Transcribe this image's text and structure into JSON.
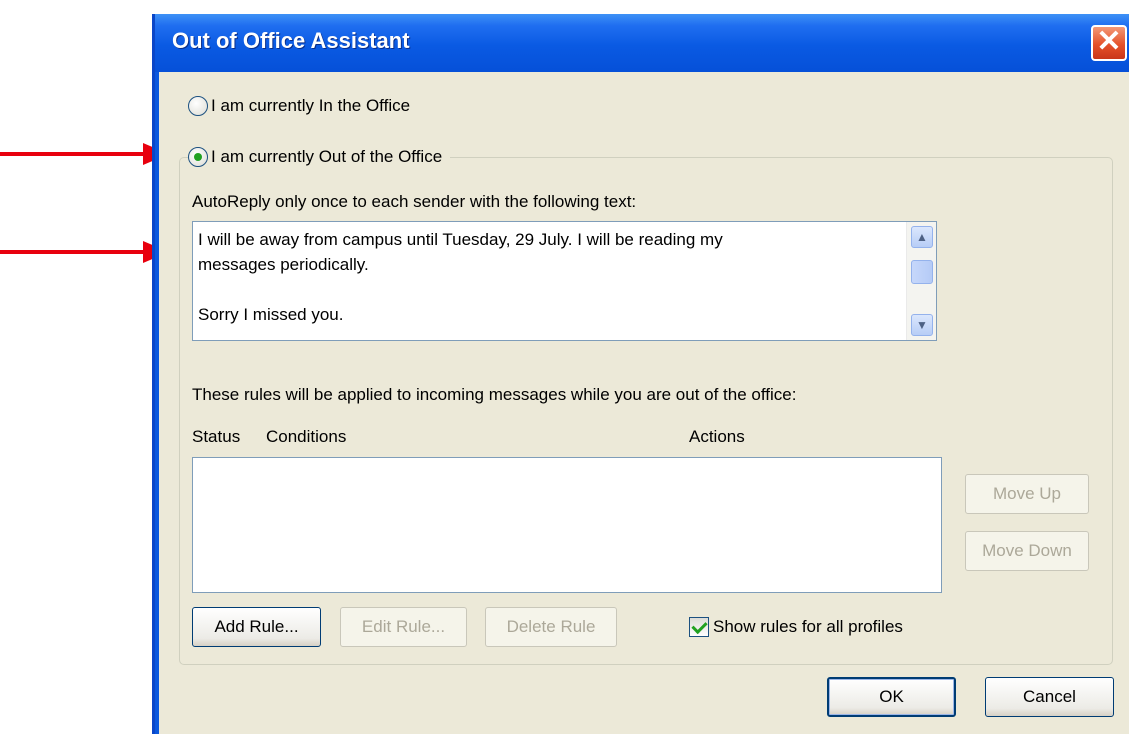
{
  "window": {
    "title": "Out of Office Assistant",
    "close_label": "✕"
  },
  "status": {
    "in_office_label": "I am currently In the Office",
    "out_office_label": "I am currently Out of the Office",
    "selected": "out_office"
  },
  "autoreply": {
    "label": "AutoReply only once to each sender with the following text:",
    "text": "I will be away from campus until Tuesday, 29 July.  I will be reading my\nmessages periodically.\n\nSorry I missed you."
  },
  "rules": {
    "intro": "These rules will be applied to incoming messages while you are out of the office:",
    "columns": [
      "Status",
      "Conditions",
      "Actions"
    ],
    "rows": [],
    "move_up_label": "Move Up",
    "move_down_label": "Move Down",
    "add_rule_label": "Add Rule...",
    "edit_rule_label": "Edit Rule...",
    "delete_rule_label": "Delete Rule",
    "show_all_profiles_label": "Show rules for all profiles",
    "show_all_profiles_checked": true
  },
  "buttons": {
    "ok_label": "OK",
    "cancel_label": "Cancel"
  },
  "colors": {
    "titlebar": "#0a5ae3",
    "dialog_bg": "#ece9d8",
    "annotation_arrow": "#e8000e"
  }
}
